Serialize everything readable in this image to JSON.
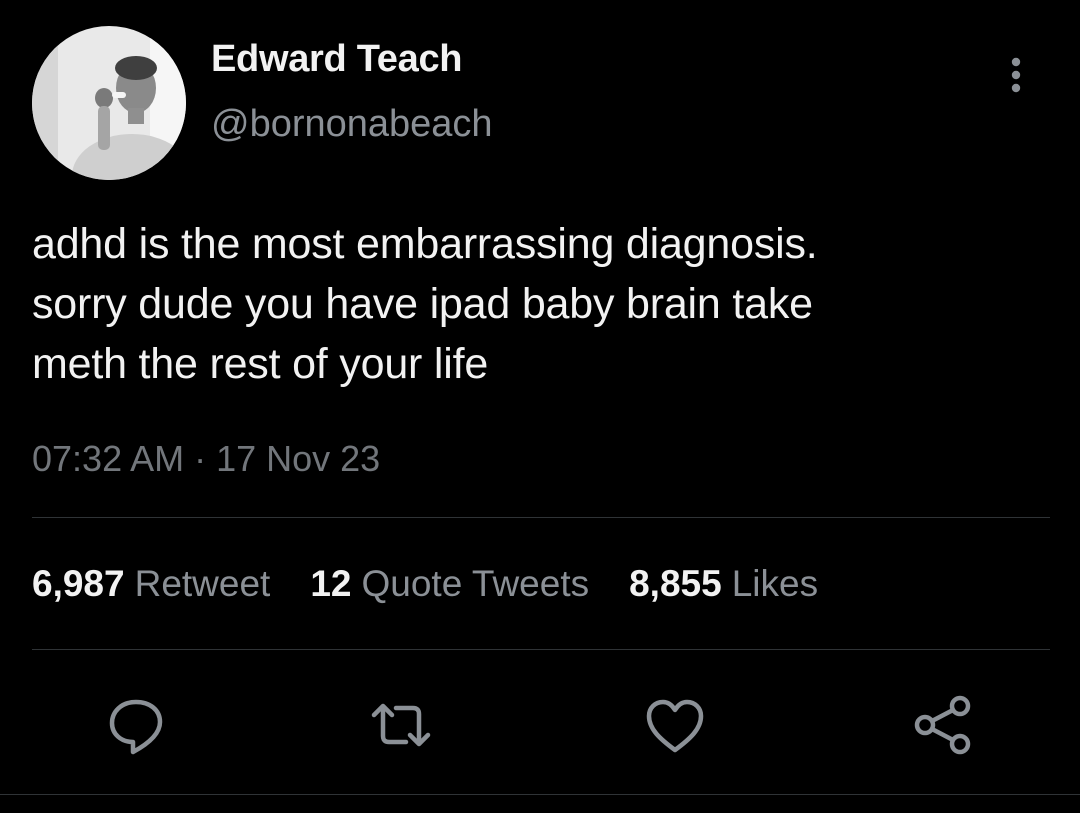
{
  "tweet": {
    "author": {
      "display_name": "Edward Teach",
      "handle": "@bornonabeach"
    },
    "text": "adhd is the most embarrassing diagnosis.\nsorry dude you have ipad baby brain take\nmeth the rest of your life",
    "timestamp": "07:32 AM · 17 Nov 23",
    "stats": {
      "retweets": {
        "count": "6,987",
        "label": "Retweet"
      },
      "quotes": {
        "count": "12",
        "label": "Quote Tweets"
      },
      "likes": {
        "count": "8,855",
        "label": "Likes"
      }
    }
  },
  "icons": {
    "more": "more-vertical-icon",
    "reply": "reply-icon",
    "retweet": "retweet-icon",
    "like": "heart-icon",
    "share": "share-icon"
  },
  "colors": {
    "background": "#000000",
    "text_primary": "#f2f2f2",
    "text_secondary": "#8b9096",
    "divider": "#2f3336"
  }
}
